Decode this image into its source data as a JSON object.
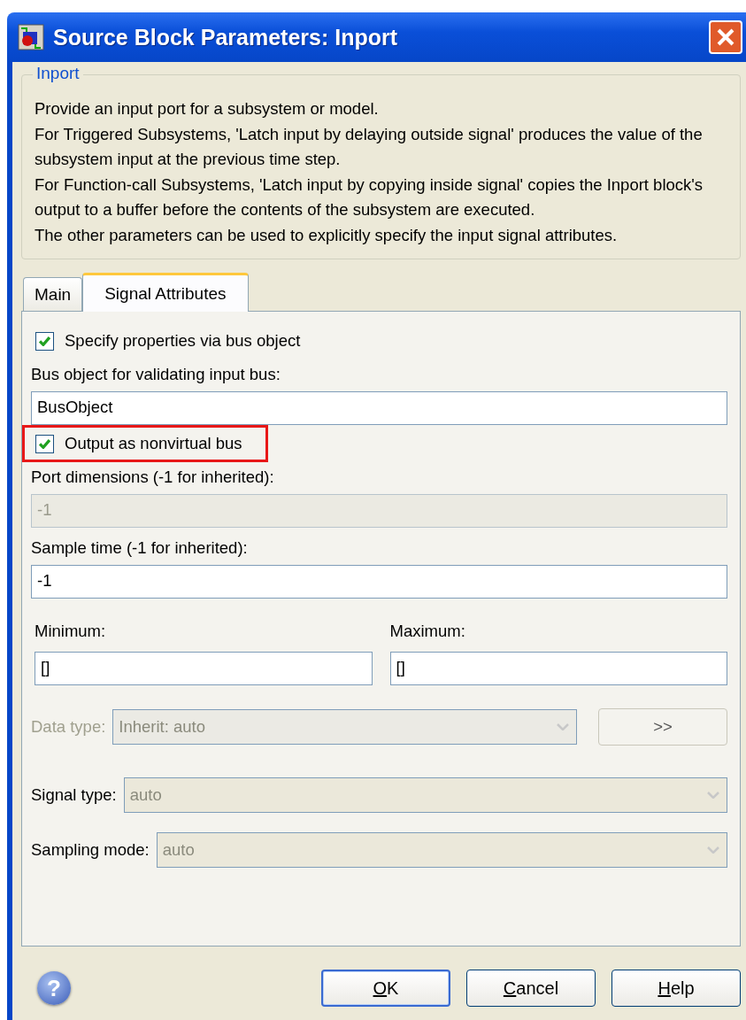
{
  "window": {
    "title": "Source Block Parameters: Inport"
  },
  "description": {
    "legend": "Inport",
    "lines": [
      "Provide an input port for a subsystem or model.",
      "For Triggered Subsystems, 'Latch input by delaying outside signal' produces the value of the subsystem input at the previous time step.",
      "For Function-call Subsystems, 'Latch input by copying inside signal' copies the Inport block's output to a buffer before the contents of the subsystem are executed.",
      "The other parameters can be used to explicitly specify the input signal attributes."
    ]
  },
  "tabs": [
    {
      "label": "Main",
      "selected": false
    },
    {
      "label": "Signal Attributes",
      "selected": true
    }
  ],
  "fields": [
    {
      "kind": "checkbox",
      "label": "Specify properties via bus object",
      "checked": true,
      "highlighted": false
    },
    {
      "kind": "text",
      "label": "Bus object for validating input bus:",
      "value": "BusObject",
      "disabled": false
    },
    {
      "kind": "checkbox",
      "label": "Output as nonvirtual bus",
      "checked": true,
      "highlighted": true
    },
    {
      "kind": "text",
      "label": "Port dimensions (-1 for inherited):",
      "value": "-1",
      "disabled": true
    },
    {
      "kind": "text",
      "label": "Sample time (-1 for inherited):",
      "value": "-1",
      "disabled": false
    },
    {
      "kind": "pair",
      "items": [
        {
          "label": "Minimum:",
          "value": "[]"
        },
        {
          "label": "Maximum:",
          "value": "[]"
        }
      ]
    },
    {
      "kind": "select",
      "label": "Data type:",
      "value": "Inherit: auto",
      "disabled": true,
      "label_disabled": true,
      "button": ">>"
    },
    {
      "kind": "select",
      "label": "Signal type:",
      "value": "auto",
      "disabled": true,
      "label_disabled": false
    },
    {
      "kind": "select",
      "label": "Sampling mode:",
      "value": "auto",
      "disabled": true,
      "label_disabled": false
    }
  ],
  "help_glyph": "?",
  "buttons": [
    {
      "label": "OK",
      "default": true,
      "underline_first": true
    },
    {
      "label": "Cancel",
      "default": false,
      "underline_first": true
    },
    {
      "label": "Help",
      "default": false,
      "underline_first": true
    }
  ]
}
